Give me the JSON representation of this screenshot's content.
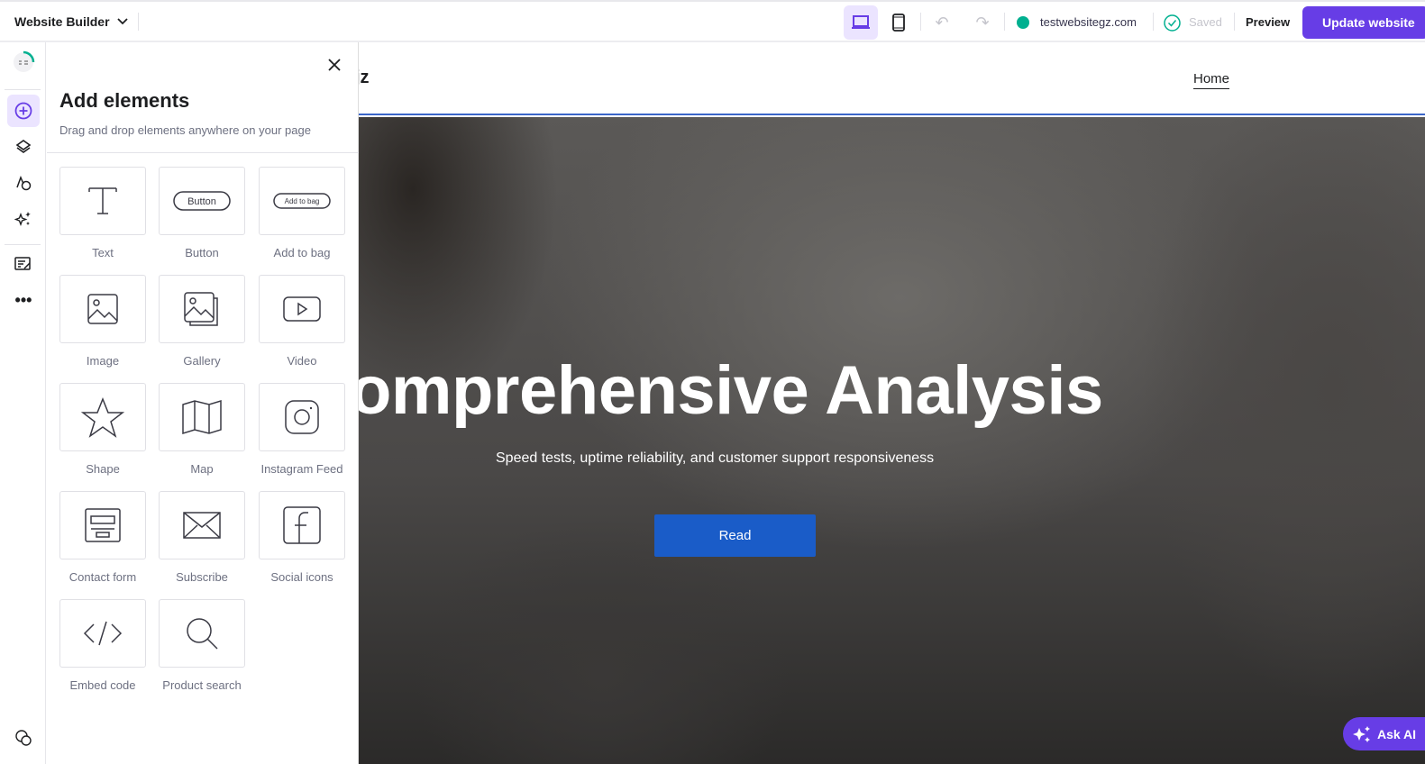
{
  "topbar": {
    "app_name": "Website Builder",
    "domain": "testwebsitegz.com",
    "saved": "Saved",
    "preview": "Preview",
    "update": "Update website",
    "accent": "#673de6",
    "status_color": "#00b090"
  },
  "panel": {
    "title": "Add elements",
    "subtitle": "Drag and drop elements anywhere on your page",
    "elements": [
      {
        "label": "Text",
        "icon": "text-icon"
      },
      {
        "label": "Button",
        "icon": "button-icon",
        "preview": "Button"
      },
      {
        "label": "Add to bag",
        "icon": "add-to-bag-icon",
        "preview": "Add to bag"
      },
      {
        "label": "Image",
        "icon": "image-icon"
      },
      {
        "label": "Gallery",
        "icon": "gallery-icon"
      },
      {
        "label": "Video",
        "icon": "video-icon"
      },
      {
        "label": "Shape",
        "icon": "star-icon"
      },
      {
        "label": "Map",
        "icon": "map-icon"
      },
      {
        "label": "Instagram Feed",
        "icon": "instagram-icon"
      },
      {
        "label": "Contact form",
        "icon": "contact-form-icon"
      },
      {
        "label": "Subscribe",
        "icon": "envelope-icon"
      },
      {
        "label": "Social icons",
        "icon": "facebook-icon"
      },
      {
        "label": "Embed code",
        "icon": "code-icon"
      },
      {
        "label": "Product search",
        "icon": "search-icon"
      }
    ]
  },
  "site": {
    "logo_fragment": "jz",
    "nav_home": "Home",
    "hero_title": "omprehensive Analysis",
    "hero_subtitle": "Speed tests, uptime reliability, and customer support responsiveness",
    "cta": "Read",
    "cta_color": "#1a5cc8"
  },
  "ask_ai": "Ask AI"
}
